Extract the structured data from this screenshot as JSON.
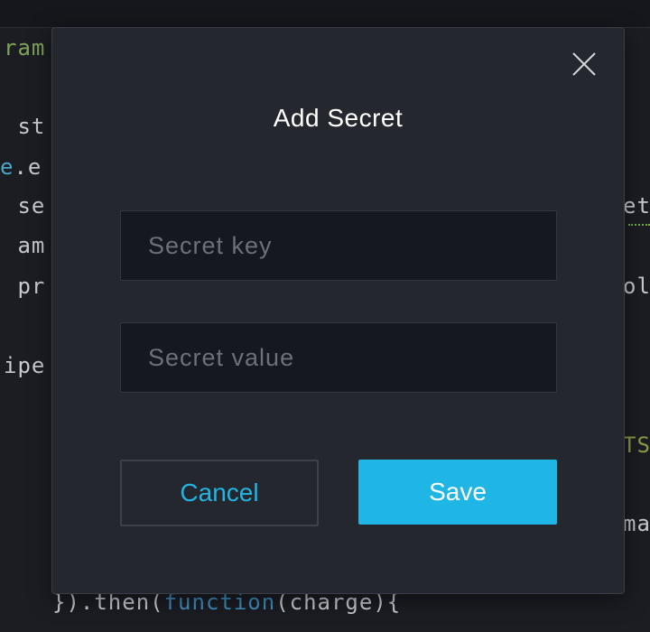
{
  "background_code": {
    "fragments_left": [
      {
        "text": "ram",
        "class": "c-green"
      },
      {
        "text": " st",
        "class": ""
      },
      {
        "text_prefix": "e",
        "prefix_class": "c-blue",
        "text": ".e",
        "class": ""
      },
      {
        "text": " se",
        "class": ""
      },
      {
        "text": " am",
        "class": ""
      },
      {
        "text": " pr",
        "class": ""
      },
      {
        "text": "ipe",
        "class": ""
      }
    ],
    "fragments_right": [
      {
        "text": "et",
        "class": ""
      },
      {
        "text": "ol",
        "class": ""
      },
      {
        "text": "TS",
        "class": "c-olive"
      },
      {
        "text": "ma",
        "class": ""
      }
    ],
    "bottom_line": {
      "pre": "}).then(",
      "keyword": "function",
      "post": "(charge){"
    }
  },
  "modal": {
    "title": "Add Secret",
    "close_icon": "close-icon",
    "key_field": {
      "value": "",
      "placeholder": "Secret key"
    },
    "value_field": {
      "value": "",
      "placeholder": "Secret value"
    },
    "cancel_label": "Cancel",
    "save_label": "Save"
  },
  "colors": {
    "accent": "#1fb6e6",
    "modal_bg": "#24272e",
    "page_bg": "#1b1d23"
  }
}
